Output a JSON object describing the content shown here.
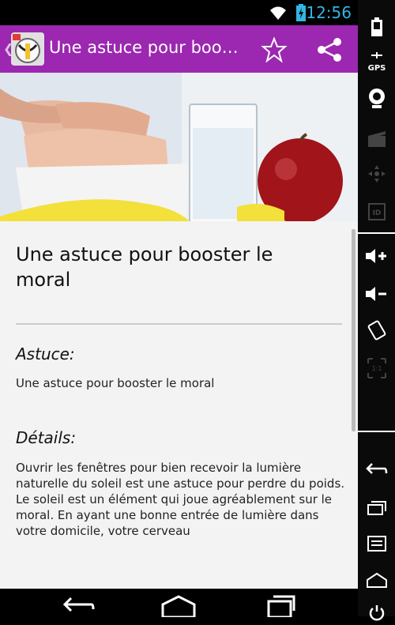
{
  "status_bar": {
    "time": "12:56"
  },
  "action_bar": {
    "title": "Une astuce pour booster le moral"
  },
  "article": {
    "title": "Une astuce pour booster le moral",
    "astuce_label": "Astuce:",
    "astuce_text": "Une astuce pour booster le moral",
    "details_label": "Détails:",
    "details_text": "Ouvrir les fenêtres pour bien recevoir la lumière naturelle du soleil est une astuce pour perdre du poids. Le soleil est un élément qui joue agréablement sur le moral. En ayant une bonne entrée de lumière dans votre domicile, votre cerveau"
  },
  "side_panel": {
    "gps_label": "GPS",
    "id_label": "ID",
    "ratio_label": "1:1"
  },
  "colors": {
    "action_bar": "#9c27b0",
    "clock": "#33b5e5",
    "content_bg": "#f3f3f3"
  }
}
